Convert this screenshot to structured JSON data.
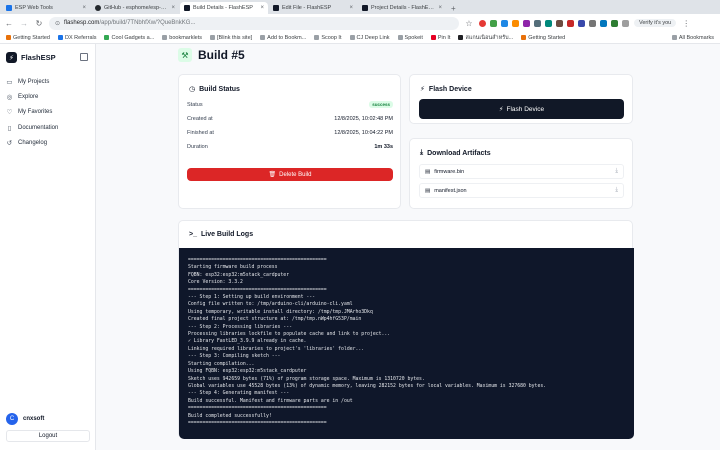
{
  "browser": {
    "tabs": [
      {
        "label": "ESP Web Tools",
        "color": "#1a73e8",
        "active": false
      },
      {
        "label": "GitHub - esphome/esp-w...",
        "color": "#24292e",
        "active": false
      },
      {
        "label": "Build Details - FlashESP",
        "color": "#111827",
        "active": true
      },
      {
        "label": "Edit File - FlashESP",
        "color": "#111827",
        "active": false
      },
      {
        "label": "Project Details - FlashESP",
        "color": "#111827",
        "active": false
      }
    ],
    "url_host": "flashesp.com",
    "url_path": "/app/build/7TNbhfXw/?QueBnkKG...",
    "profile_label": "Verify it's you",
    "bookmarks": [
      "Getting Started",
      "DX Referrals",
      "Cool Gadgets a...",
      "bookmarklets",
      "[Blink this site]",
      "Add to Bookm...",
      "Scoop It",
      "CJ Deep Link",
      "Spokeit",
      "Pin It",
      "สแกนเนิอนสำหรับ...",
      "Getting Started"
    ],
    "all_bookmarks": "All Bookmarks"
  },
  "sidebar": {
    "brand": "FlashESP",
    "items": [
      {
        "label": "My Projects",
        "icon": "folder-icon"
      },
      {
        "label": "Explore",
        "icon": "compass-icon"
      },
      {
        "label": "My Favorites",
        "icon": "heart-icon"
      },
      {
        "label": "Documentation",
        "icon": "book-icon"
      },
      {
        "label": "Changelog",
        "icon": "history-icon"
      }
    ],
    "user_initial": "C",
    "username": "cnxsoft",
    "logout": "Logout"
  },
  "page": {
    "title": "Build #5"
  },
  "build_status": {
    "title": "Build Status",
    "status_label": "Status",
    "status_value": "success",
    "created_label": "Created at",
    "created_value": "12/8/2025, 10:02:48 PM",
    "finished_label": "Finished at",
    "finished_value": "12/8/2025, 10:04:22 PM",
    "duration_label": "Duration",
    "duration_value": "1m 33s",
    "delete_label": "Delete Build"
  },
  "flash_device": {
    "title": "Flash Device",
    "button": "Flash Device"
  },
  "artifacts": {
    "title": "Download Artifacts",
    "files": [
      "firmware.bin",
      "manifest.json"
    ]
  },
  "logs": {
    "title": "Live Build Logs",
    "lines": [
      "================================================",
      "Starting firmware build process",
      "FQBN: esp32:esp32:m5stack_cardputer",
      "Core Version: 3.3.2",
      "================================================",
      "--- Step 1: Setting up build environment ---",
      "Config file written to: /tmp/arduino-cli/arduino-cli.yaml",
      "Using temporary, writable install directory: /tmp/tmp.JMArho3Dkq",
      "Created final project structure at: /tmp/tmp.nWp4hfG53P/main",
      "--- Step 2: Processing libraries ---",
      "Processing libraries lockfile to populate cache and link to project...",
      "✓ Library FastLED_3.9.9 already in cache.",
      "Linking required libraries to project's 'libraries' folder...",
      "--- Step 3: Compiling sketch ---",
      "Starting compilation...",
      "Using FQBN: esp32:esp32:m5stack_cardputer",
      "Sketch uses 942659 bytes (71%) of program storage space. Maximum is 1310720 bytes.",
      "Global variables use 45528 bytes (13%) of dynamic memory, leaving 282152 bytes for local variables. Maximum is 327680 bytes.",
      "--- Step 4: Generating manifest ---",
      "Build successful. Manifest and firmware parts are in /out",
      "================================================",
      "Build completed successfully!",
      "================================================"
    ]
  }
}
